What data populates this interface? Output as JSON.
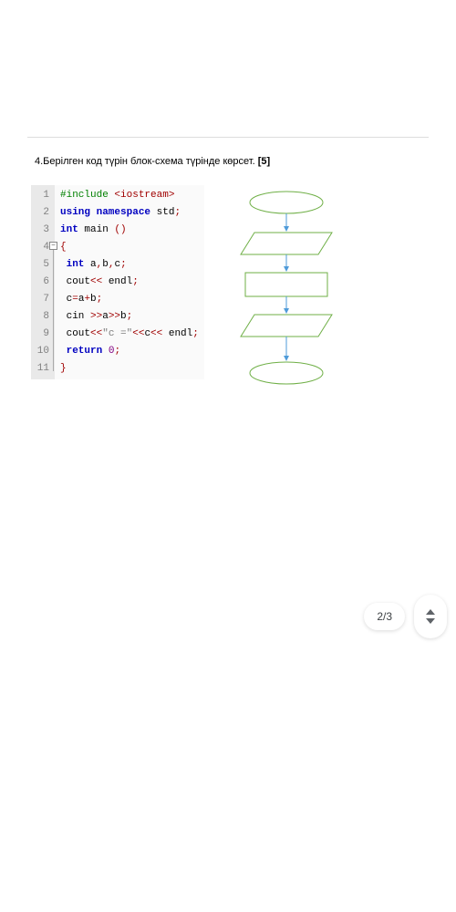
{
  "question": {
    "prefix": "4.Берілген код түрін блок-схема түрінде көрсет. ",
    "points": "[5]"
  },
  "code": {
    "lines": [
      {
        "n": "1",
        "tokens": [
          [
            "c-green",
            "#include "
          ],
          [
            "c-red",
            "<iostream>"
          ]
        ]
      },
      {
        "n": "2",
        "tokens": [
          [
            "c-blue",
            "using namespace "
          ],
          [
            "c-black",
            "std"
          ],
          [
            "c-red",
            ";"
          ]
        ]
      },
      {
        "n": "3",
        "tokens": [
          [
            "c-blue",
            "int "
          ],
          [
            "c-black",
            "main "
          ],
          [
            "c-red",
            "()"
          ]
        ]
      },
      {
        "n": "4",
        "fold": true,
        "tokens": [
          [
            "c-red",
            "{"
          ]
        ]
      },
      {
        "n": "5",
        "tokens": [
          [
            "c-blue",
            "int "
          ],
          [
            "c-black",
            "a"
          ],
          [
            "c-red",
            ","
          ],
          [
            "c-black",
            "b"
          ],
          [
            "c-red",
            ","
          ],
          [
            "c-black",
            "c"
          ],
          [
            "c-red",
            ";"
          ]
        ]
      },
      {
        "n": "6",
        "tokens": [
          [
            "c-black",
            "cout"
          ],
          [
            "c-red",
            "<< "
          ],
          [
            "c-black",
            "endl"
          ],
          [
            "c-red",
            ";"
          ]
        ]
      },
      {
        "n": "7",
        "tokens": [
          [
            "c-black",
            "c"
          ],
          [
            "c-red",
            "="
          ],
          [
            "c-black",
            "a"
          ],
          [
            "c-red",
            "+"
          ],
          [
            "c-black",
            "b"
          ],
          [
            "c-red",
            ";"
          ]
        ]
      },
      {
        "n": "8",
        "tokens": [
          [
            "c-black",
            "cin "
          ],
          [
            "c-red",
            ">>"
          ],
          [
            "c-black",
            "a"
          ],
          [
            "c-red",
            ">>"
          ],
          [
            "c-black",
            "b"
          ],
          [
            "c-red",
            ";"
          ]
        ]
      },
      {
        "n": "9",
        "tokens": [
          [
            "c-black",
            "cout"
          ],
          [
            "c-red",
            "<<"
          ],
          [
            "c-gray",
            "\"c =\""
          ],
          [
            "c-red",
            "<<"
          ],
          [
            "c-black",
            "c"
          ],
          [
            "c-red",
            "<< "
          ],
          [
            "c-black",
            "endl"
          ],
          [
            "c-red",
            ";"
          ]
        ]
      },
      {
        "n": "10",
        "tokens": [
          [
            "c-blue",
            "return "
          ],
          [
            "c-purple",
            "0"
          ],
          [
            "c-red",
            ";"
          ]
        ]
      },
      {
        "n": "11",
        "end": true,
        "tokens": [
          [
            "c-red",
            "}"
          ]
        ]
      }
    ]
  },
  "flowchart": {
    "shapes": [
      "terminator",
      "parallelogram",
      "rectangle",
      "parallelogram",
      "terminator"
    ]
  },
  "pager": {
    "label": "2/3"
  }
}
